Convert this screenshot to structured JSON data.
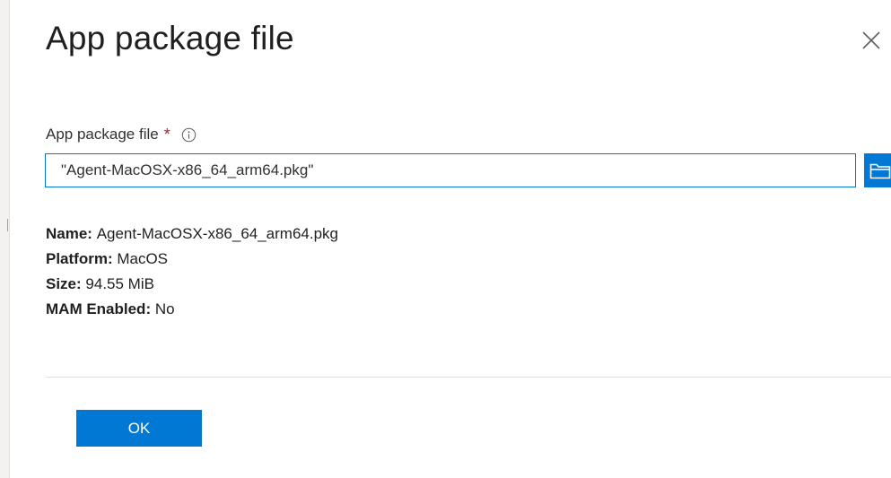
{
  "panel": {
    "title": "App package file"
  },
  "field": {
    "label": "App package file",
    "required_marker": "*",
    "value": "\"Agent-MacOSX-x86_64_arm64.pkg\""
  },
  "details": {
    "name_label": "Name:",
    "name_value": "Agent-MacOSX-x86_64_arm64.pkg",
    "platform_label": "Platform:",
    "platform_value": "MacOS",
    "size_label": "Size:",
    "size_value": "94.55 MiB",
    "mam_label": "MAM Enabled:",
    "mam_value": "No"
  },
  "actions": {
    "ok_label": "OK"
  },
  "icons": {
    "close": "close-icon",
    "info": "info-icon",
    "browse": "folder-icon"
  },
  "colors": {
    "accent": "#0078d4",
    "required": "#a4262c",
    "text": "#323130"
  }
}
